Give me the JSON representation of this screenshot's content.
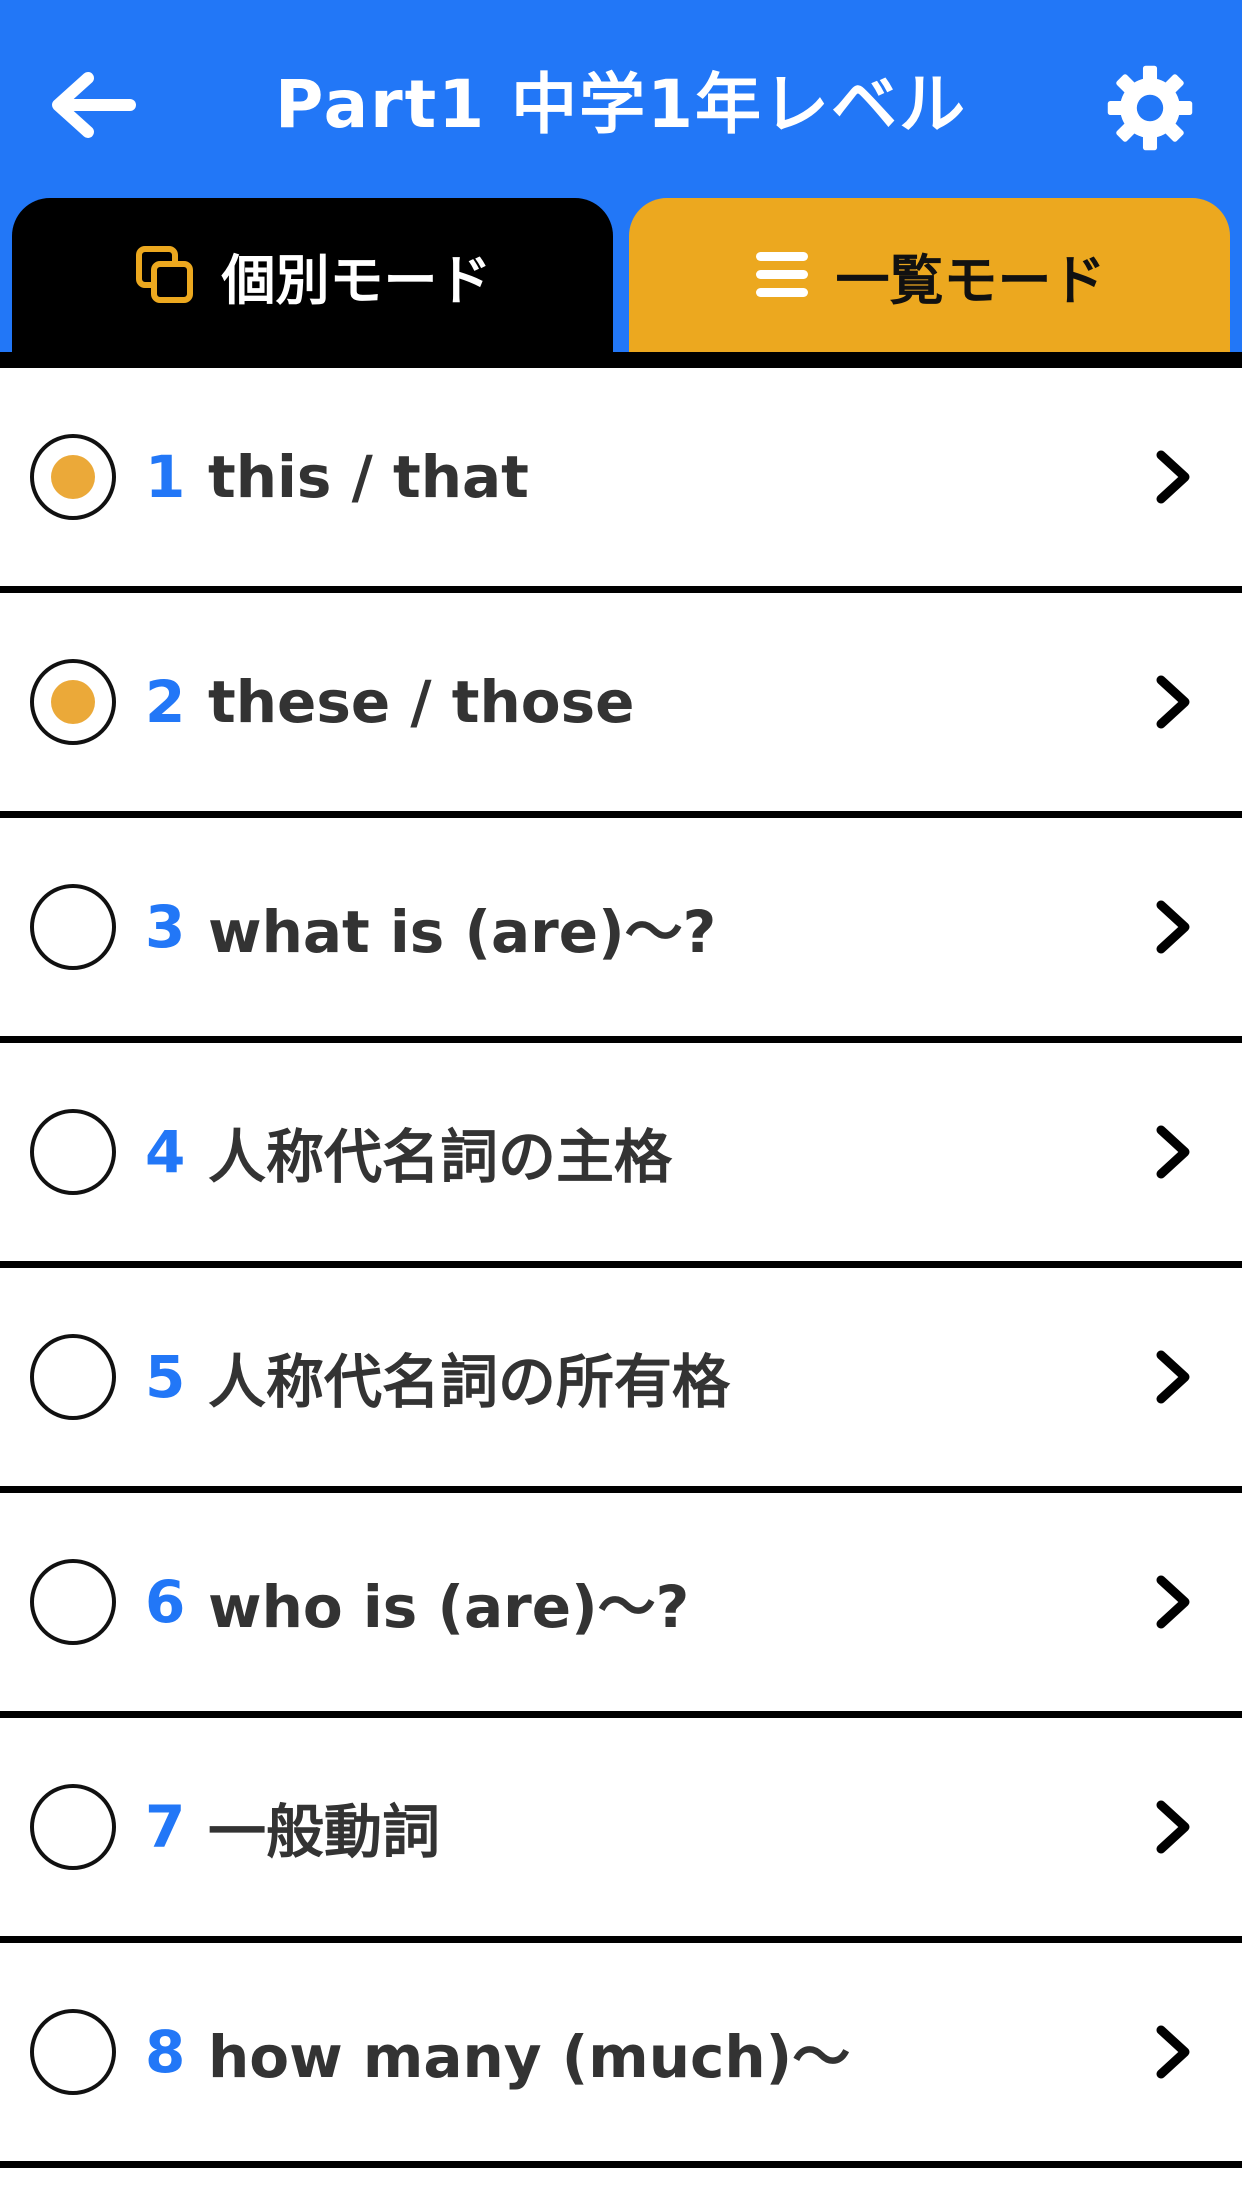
{
  "header": {
    "title": "Part1  中学1年レベル",
    "back_icon": "arrow-left-icon",
    "settings_icon": "gear-icon",
    "background_color": "#2277f7"
  },
  "tabs": [
    {
      "label": "個別モード",
      "icon": "copy-icon",
      "active": true,
      "background_color": "#000000"
    },
    {
      "label": "一覧モード",
      "icon": "list-icon",
      "active": false,
      "background_color": "#eca81f"
    }
  ],
  "lessons": [
    {
      "number": "1",
      "title": "this / that",
      "completed": true
    },
    {
      "number": "2",
      "title": "these / those",
      "completed": true
    },
    {
      "number": "3",
      "title": "what is (are)～?",
      "completed": false
    },
    {
      "number": "4",
      "title": "人称代名詞の主格",
      "completed": false
    },
    {
      "number": "5",
      "title": "人称代名詞の所有格",
      "completed": false
    },
    {
      "number": "6",
      "title": "who is (are)～?",
      "completed": false
    },
    {
      "number": "7",
      "title": "一般動詞",
      "completed": false
    },
    {
      "number": "8",
      "title": "how many (much)～",
      "completed": false
    }
  ],
  "colors": {
    "accent_blue": "#2277f7",
    "accent_orange": "#eca81f",
    "radio_fill": "#eba939"
  }
}
